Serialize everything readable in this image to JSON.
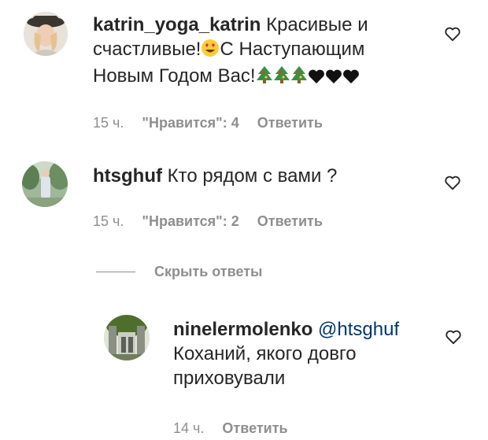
{
  "comments": [
    {
      "username": "katrin_yoga_katrin",
      "text_part1": " Красивые и счастливые!",
      "text_part2": "С Наступающим Новым Годом Вас!",
      "emojis": [
        "smiling-face-with-heart-eyes",
        "christmas-tree",
        "christmas-tree",
        "christmas-tree",
        "black-heart",
        "black-heart",
        "black-heart"
      ],
      "time": "15 ч.",
      "likes": "\"Нравится\": 4",
      "reply_label": "Ответить"
    },
    {
      "username": "htsghuf",
      "text": " Кто рядом с вами ?",
      "time": "15 ч.",
      "likes": "\"Нравится\": 2",
      "reply_label": "Ответить"
    }
  ],
  "replies_toggle": "Скрыть ответы",
  "reply": {
    "username": "ninelermolenko",
    "mention": "@htsghuf",
    "text": "Коханий, якого довго приховували",
    "time": "14 ч.",
    "reply_label": "Ответить"
  },
  "colors": {
    "text": "#262626",
    "meta": "#8e8e8e",
    "mention": "#00376b"
  }
}
